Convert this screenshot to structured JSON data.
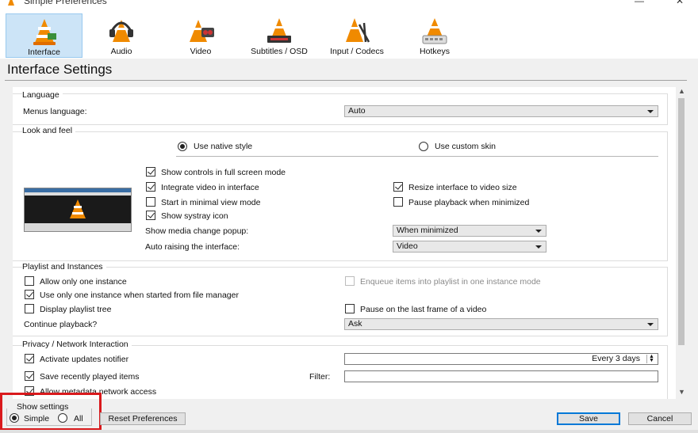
{
  "window": {
    "title": "Simple Preferences",
    "minimize": "—",
    "close": "✕"
  },
  "toolbar": {
    "items": [
      {
        "label": "Interface",
        "icon": "vlc-cone-interface-icon",
        "selected": true
      },
      {
        "label": "Audio",
        "icon": "headphones-cone-icon"
      },
      {
        "label": "Video",
        "icon": "video-cone-icon"
      },
      {
        "label": "Subtitles / OSD",
        "icon": "subtitles-cone-icon"
      },
      {
        "label": "Input / Codecs",
        "icon": "codec-cone-icon"
      },
      {
        "label": "Hotkeys",
        "icon": "hotkeys-cone-icon"
      }
    ]
  },
  "page": {
    "title": "Interface Settings"
  },
  "language": {
    "group_title": "Language",
    "menus_label": "Menus language:",
    "menus_value": "Auto"
  },
  "look": {
    "group_title": "Look and feel",
    "native_style": "Use native style",
    "custom_skin": "Use custom skin",
    "fullscreen_controls": "Show controls in full screen mode",
    "integrate_video": "Integrate video in interface",
    "resize_interface": "Resize interface to video size",
    "minimal_view": "Start in minimal view mode",
    "pause_minimized": "Pause playback when minimized",
    "systray": "Show systray icon",
    "media_popup_label": "Show media change popup:",
    "media_popup_value": "When minimized",
    "auto_raise_label": "Auto raising the interface:",
    "auto_raise_value": "Video"
  },
  "playlist": {
    "group_title": "Playlist and Instances",
    "one_instance": "Allow only one instance",
    "enqueue": "Enqueue items into playlist in one instance mode",
    "one_instance_fm": "Use only one instance when started from file manager",
    "playlist_tree": "Display playlist tree",
    "pause_last_frame": "Pause on the last frame of a video",
    "continue_label": "Continue playback?",
    "continue_value": "Ask"
  },
  "privacy": {
    "group_title": "Privacy / Network Interaction",
    "updates": "Activate updates notifier",
    "updates_value": "Every 3 days",
    "recent": "Save recently played items",
    "filter_label": "Filter:",
    "filter_value": "",
    "metadata": "Allow metadata network access"
  },
  "footer": {
    "show_settings": "Show settings",
    "simple": "Simple",
    "all": "All",
    "reset": "Reset Preferences",
    "save": "Save",
    "cancel": "Cancel"
  },
  "colors": {
    "accent": "#0078d7",
    "highlight_border": "#d9191c",
    "selected_tab": "#cce4f7",
    "cone_orange": "#f08a00"
  }
}
